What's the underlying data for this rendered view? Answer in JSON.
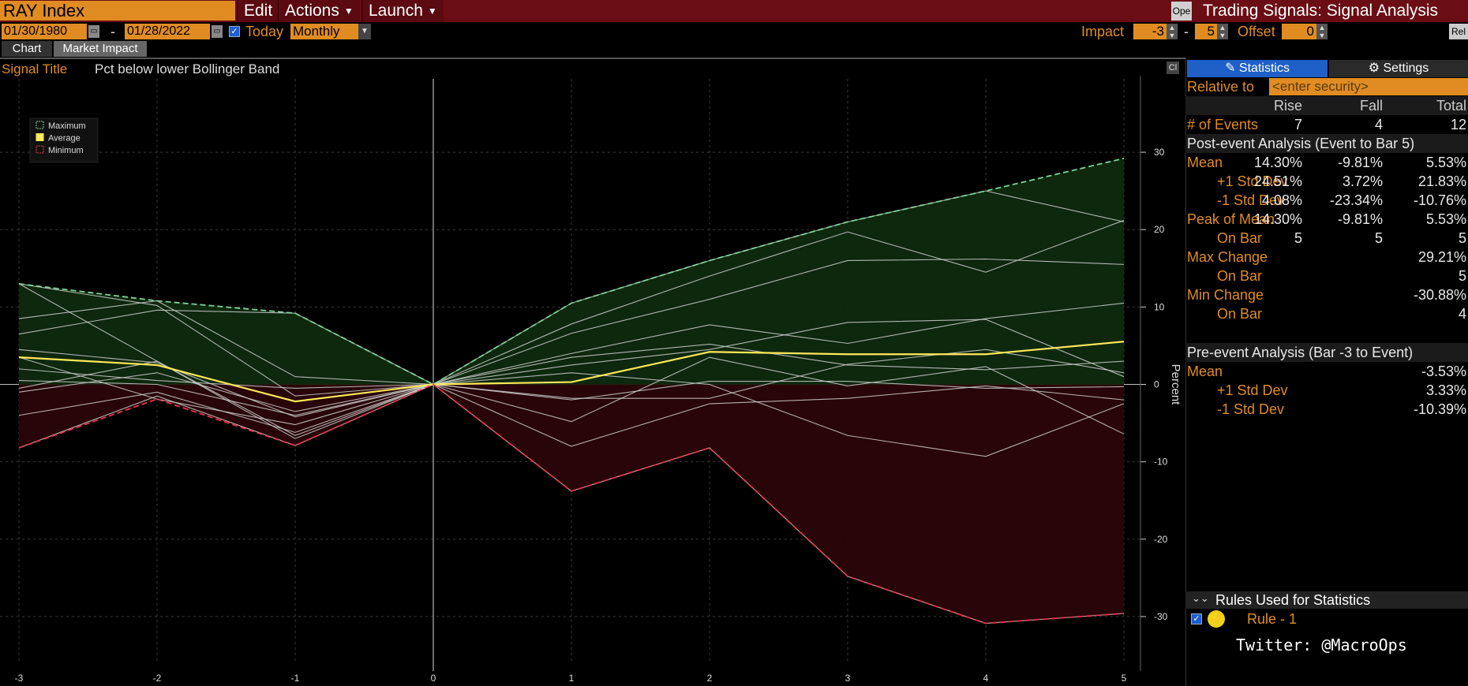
{
  "toolbar": {
    "ticker": "RAY Index",
    "menus": [
      "Edit",
      "Actions",
      "Launch"
    ],
    "open_button": "Ope",
    "window_title": "Trading Signals: Signal Analysis",
    "start_date": "01/30/1980",
    "date_separator": "-",
    "end_date": "01/28/2022",
    "today_label": "Today",
    "today_checked": true,
    "period": "Monthly",
    "impact_label": "Impact",
    "impact_from": "-3",
    "impact_separator": "-",
    "impact_to": "5",
    "offset_label": "Offset",
    "offset_value": "0",
    "rel_button": "Rel"
  },
  "tabs": [
    "Chart",
    "Market Impact"
  ],
  "signal": {
    "label": "Signal Title",
    "value": "Pct below lower Bollinger Band"
  },
  "legend": [
    "Maximum",
    "Average",
    "Minimum"
  ],
  "colors": {
    "maximum": "#7fd39a",
    "average": "#ffe85a",
    "minimum": "#e8334d",
    "accent": "#e08c22",
    "topbar": "#6b0d14"
  },
  "chart_data": {
    "type": "line",
    "ylabel": "Percent",
    "x": [
      -3,
      -2,
      -1,
      0,
      1,
      2,
      3,
      4,
      5
    ],
    "xlim": [
      -3,
      5
    ],
    "ylim": [
      -35,
      35
    ],
    "yticks": [
      30,
      20,
      10,
      0,
      -10,
      -20,
      -30
    ],
    "grid": true,
    "legend_position": "top-left",
    "series": [
      {
        "name": "Maximum",
        "values": [
          13.0,
          10.8,
          9.2,
          0,
          10.5,
          16.0,
          21.0,
          25.0,
          29.21
        ]
      },
      {
        "name": "Average",
        "values": [
          3.5,
          2.5,
          -2.2,
          0,
          0.3,
          4.2,
          3.9,
          3.9,
          5.53
        ]
      },
      {
        "name": "Minimum",
        "values": [
          -8.2,
          -1.9,
          -7.9,
          0,
          -13.8,
          -8.2,
          -24.8,
          -30.88,
          -29.6
        ]
      }
    ],
    "events": [
      [
        13.0,
        10.2,
        -1.5,
        0,
        7.8,
        14.0,
        19.7,
        14.5,
        21.2
      ],
      [
        8.5,
        10.8,
        1.0,
        0,
        10.5,
        16.0,
        21.0,
        25.0,
        21.0
      ],
      [
        4.5,
        2.8,
        -4.2,
        0,
        6.6,
        11.0,
        16.0,
        16.2,
        15.5
      ],
      [
        -4.0,
        -1.0,
        -6.2,
        0,
        4.0,
        7.7,
        5.3,
        8.5,
        10.5
      ],
      [
        2.0,
        0.5,
        -0.5,
        0,
        3.5,
        5.2,
        2.5,
        1.9,
        3.0
      ],
      [
        -0.5,
        3.0,
        -6.6,
        0,
        1.5,
        0.0,
        -6.6,
        -9.3,
        -2.5
      ],
      [
        0.5,
        0.0,
        -4.0,
        0,
        -1.8,
        -1.8,
        2.6,
        4.5,
        1.5
      ],
      [
        -1.0,
        1.5,
        -3.5,
        0,
        -2.0,
        0.4,
        0.4,
        -0.5,
        -0.3
      ],
      [
        6.5,
        9.6,
        9.2,
        0,
        -4.8,
        3.5,
        -0.2,
        2.3,
        -6.4
      ],
      [
        13.0,
        3.0,
        -7.0,
        0,
        -8.0,
        -2.5,
        -1.8,
        -0.2,
        -2.0
      ],
      [
        3.5,
        -1.9,
        -5.2,
        0,
        -13.8,
        -8.2,
        -24.8,
        -30.88,
        -29.6
      ],
      [
        -8.2,
        -1.5,
        -7.9,
        0,
        2.5,
        4.5,
        8.0,
        8.4,
        1.0
      ]
    ]
  },
  "stats_panel": {
    "tabs": [
      "Statistics",
      "Settings"
    ],
    "relative_to_label": "Relative to",
    "relative_to_placeholder": "<enter security>",
    "columns": [
      "Rise",
      "Fall",
      "Total"
    ],
    "events": {
      "label": "# of Events",
      "rise": "7",
      "fall": "4",
      "total": "12"
    },
    "post_header": "Post-event Analysis (Event to Bar 5)",
    "post_rows": [
      {
        "label": "Mean",
        "rise": "14.30%",
        "fall": "-9.81%",
        "total": "5.53%"
      },
      {
        "label": "+1 Std Dev",
        "rise": "24.51%",
        "fall": "3.72%",
        "total": "21.83%"
      },
      {
        "label": "-1 Std Dev",
        "rise": "4.08%",
        "fall": "-23.34%",
        "total": "-10.76%"
      },
      {
        "label": "Peak of Mean",
        "rise": "14.30%",
        "fall": "-9.81%",
        "total": "5.53%"
      },
      {
        "label": "On Bar",
        "rise": "5",
        "fall": "5",
        "total": "5"
      },
      {
        "label": "Max Change",
        "rise": "",
        "fall": "",
        "total": "29.21%"
      },
      {
        "label": "On Bar",
        "rise": "",
        "fall": "",
        "total": "5"
      },
      {
        "label": "Min Change",
        "rise": "",
        "fall": "",
        "total": "-30.88%"
      },
      {
        "label": "On Bar",
        "rise": "",
        "fall": "",
        "total": "4"
      }
    ],
    "pre_header": "Pre-event Analysis (Bar -3 to Event)",
    "pre_rows": [
      {
        "label": "Mean",
        "total": "-3.53%"
      },
      {
        "label": "+1 Std Dev",
        "total": "3.33%"
      },
      {
        "label": "-1 Std Dev",
        "total": "-10.39%"
      }
    ],
    "rules_header": "Rules Used for Statistics",
    "rule_label": "Rule - 1",
    "twitter": "Twitter: @MacroOps"
  }
}
